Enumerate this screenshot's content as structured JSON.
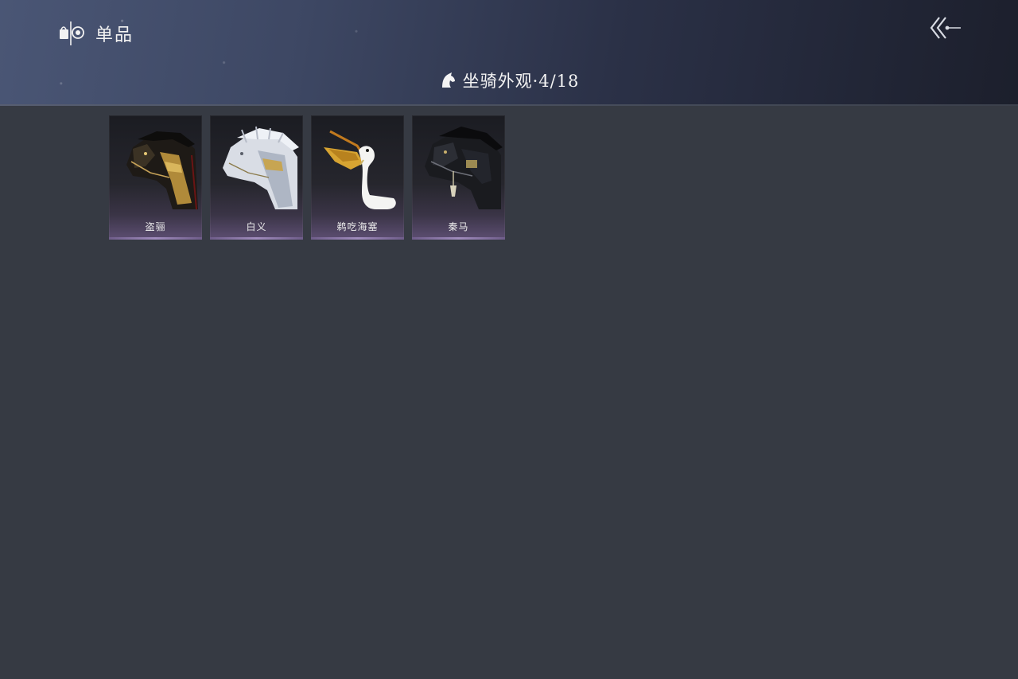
{
  "header": {
    "title": "单品",
    "brand_icon": "bag-coin-icon",
    "back_icon": "double-chevron-left-icon"
  },
  "section": {
    "icon": "horse-head-icon",
    "title": "坐骑外观·4/18"
  },
  "items": [
    {
      "name": "盗骊",
      "icon": "dark-gold-armored-horse-icon"
    },
    {
      "name": "白义",
      "icon": "white-silver-horse-icon"
    },
    {
      "name": "鹈吃海塞",
      "icon": "pelican-icon"
    },
    {
      "name": "秦马",
      "icon": "black-armored-horse-icon"
    }
  ],
  "colors": {
    "background": "#363a43",
    "header_dark": "#1c1f2c",
    "card_accent": "#a08cbd"
  }
}
